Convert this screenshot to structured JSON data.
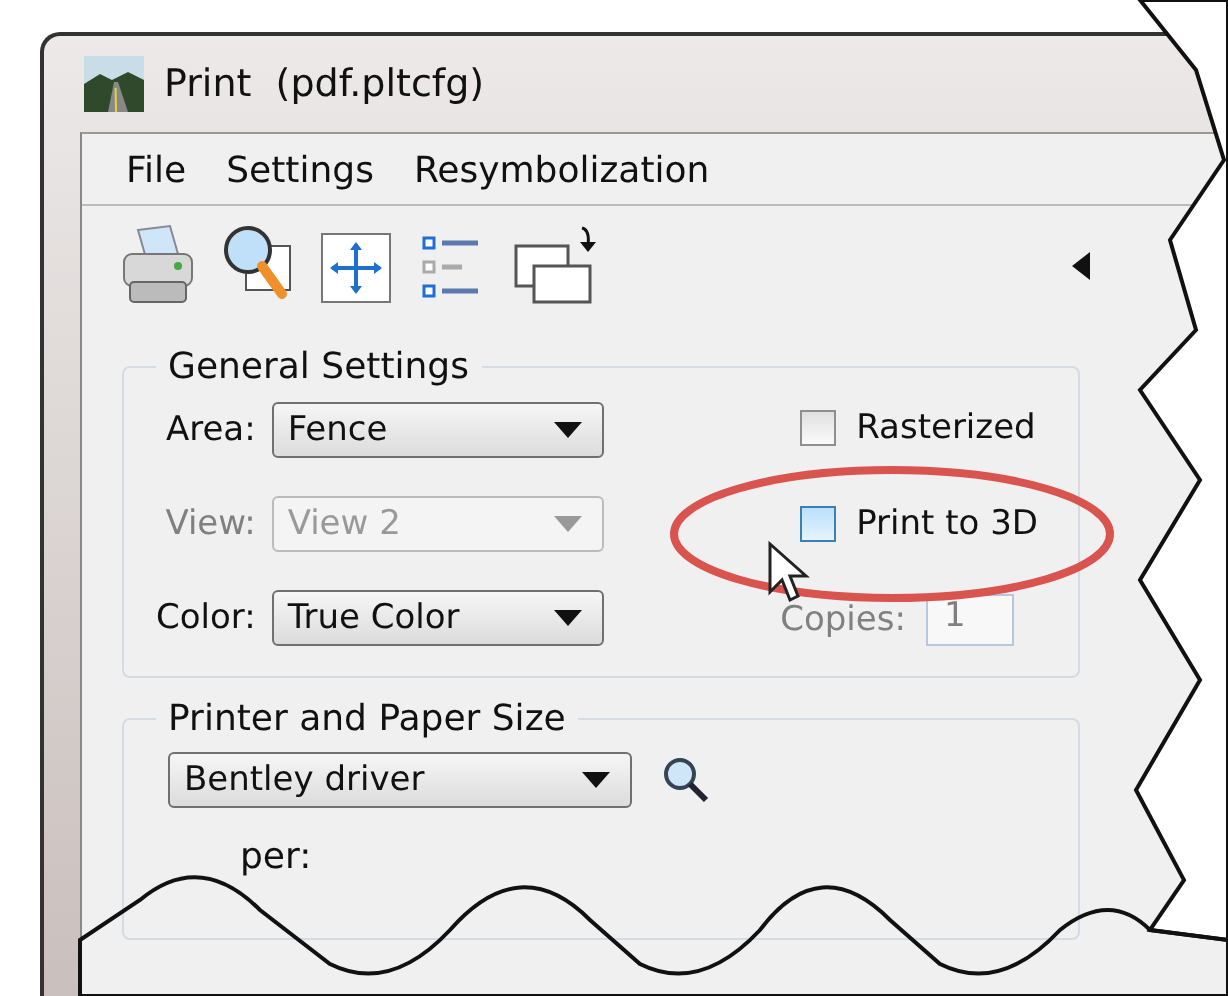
{
  "window": {
    "title": "Print  (pdf.pltcfg)"
  },
  "menu": [
    "File",
    "Settings",
    "Resymbolization"
  ],
  "general_settings": {
    "title": "General Settings",
    "fields": [
      {
        "label": "Area:",
        "value": "Fence",
        "disabled": false
      },
      {
        "label": "View:",
        "value": "View 2",
        "disabled": true
      },
      {
        "label": "Color:",
        "value": "True Color",
        "disabled": false
      }
    ],
    "checkboxes": [
      {
        "label": "Rasterized",
        "checked": false,
        "hover": false
      },
      {
        "label": "Print to 3D",
        "checked": false,
        "hover": true
      }
    ],
    "copies": {
      "label": "Copies:",
      "value": "1",
      "disabled": true
    }
  },
  "printer": {
    "title": "Printer and Paper Size",
    "driver": "Bentley driver",
    "paper_label": "per:"
  }
}
